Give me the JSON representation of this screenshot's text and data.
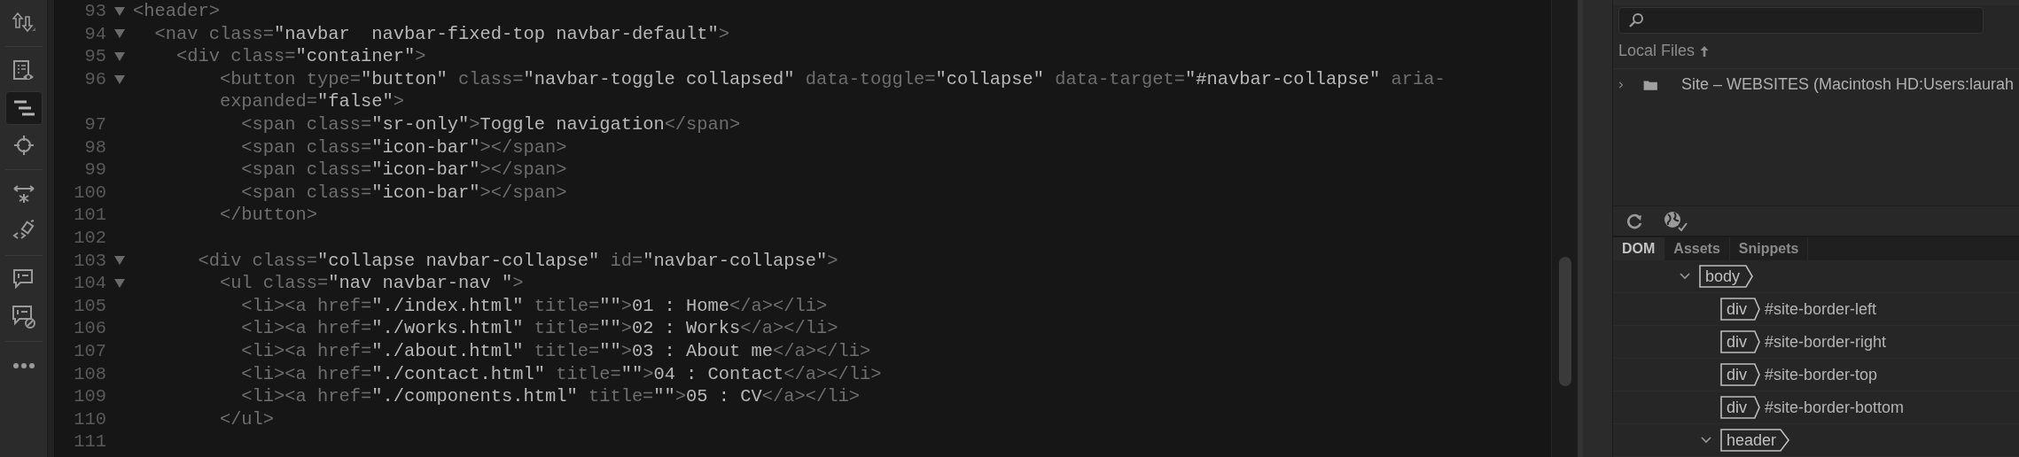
{
  "toolbar": [
    {
      "selected": false
    },
    {
      "selected": false
    },
    {
      "selected": true
    },
    {
      "selected": false
    },
    {
      "selected": false
    },
    {
      "selected": false
    },
    {
      "selected": false
    },
    {
      "selected": false
    },
    {
      "selected": false
    }
  ],
  "code_lines": [
    {
      "number": "93",
      "foldable": true,
      "segments": [
        {
          "kind": "tag",
          "text": "<header>"
        }
      ]
    },
    {
      "number": "94",
      "foldable": true,
      "segments": [
        {
          "kind": "tag",
          "text": "  <nav class="
        },
        {
          "kind": "value",
          "text": "\"navbar  navbar-fixed-top navbar-default\""
        },
        {
          "kind": "tag",
          "text": ">"
        }
      ]
    },
    {
      "number": "95",
      "foldable": true,
      "segments": [
        {
          "kind": "tag",
          "text": "    <div class="
        },
        {
          "kind": "value",
          "text": "\"container\""
        },
        {
          "kind": "tag",
          "text": ">"
        }
      ]
    },
    {
      "number": "96",
      "foldable": true,
      "segments": [
        {
          "kind": "tag",
          "text": "        <button type="
        },
        {
          "kind": "value",
          "text": "\"button\""
        },
        {
          "kind": "tag",
          "text": " class="
        },
        {
          "kind": "value",
          "text": "\"navbar-toggle collapsed\""
        },
        {
          "kind": "tag",
          "text": " data-toggle="
        },
        {
          "kind": "value",
          "text": "\"collapse\""
        },
        {
          "kind": "tag",
          "text": " data-target="
        },
        {
          "kind": "value",
          "text": "\"#navbar-collapse\""
        },
        {
          "kind": "tag",
          "text": " aria-"
        }
      ],
      "wrapped_segments": [
        {
          "kind": "tag",
          "text": "        expanded="
        },
        {
          "kind": "value",
          "text": "\"false\""
        },
        {
          "kind": "tag",
          "text": ">"
        }
      ]
    },
    {
      "number": "97",
      "foldable": false,
      "segments": [
        {
          "kind": "tag",
          "text": "          <span class="
        },
        {
          "kind": "value",
          "text": "\"sr-only\""
        },
        {
          "kind": "tag",
          "text": ">"
        },
        {
          "kind": "text",
          "text": "Toggle navigation"
        },
        {
          "kind": "tag",
          "text": "</span>"
        }
      ]
    },
    {
      "number": "98",
      "foldable": false,
      "segments": [
        {
          "kind": "tag",
          "text": "          <span class="
        },
        {
          "kind": "value",
          "text": "\"icon-bar\""
        },
        {
          "kind": "tag",
          "text": "></span>"
        }
      ]
    },
    {
      "number": "99",
      "foldable": false,
      "segments": [
        {
          "kind": "tag",
          "text": "          <span class="
        },
        {
          "kind": "value",
          "text": "\"icon-bar\""
        },
        {
          "kind": "tag",
          "text": "></span>"
        }
      ]
    },
    {
      "number": "100",
      "foldable": false,
      "segments": [
        {
          "kind": "tag",
          "text": "          <span class="
        },
        {
          "kind": "value",
          "text": "\"icon-bar\""
        },
        {
          "kind": "tag",
          "text": "></span>"
        }
      ]
    },
    {
      "number": "101",
      "foldable": false,
      "segments": [
        {
          "kind": "tag",
          "text": "        </button>"
        }
      ]
    },
    {
      "number": "102",
      "foldable": false
    },
    {
      "number": "103",
      "foldable": true,
      "segments": [
        {
          "kind": "tag",
          "text": "      <div class="
        },
        {
          "kind": "value",
          "text": "\"collapse navbar-collapse\""
        },
        {
          "kind": "tag",
          "text": " id="
        },
        {
          "kind": "value",
          "text": "\"navbar-collapse\""
        },
        {
          "kind": "tag",
          "text": ">"
        }
      ]
    },
    {
      "number": "104",
      "foldable": true,
      "segments": [
        {
          "kind": "tag",
          "text": "        <ul class="
        },
        {
          "kind": "value",
          "text": "\"nav navbar-nav \""
        },
        {
          "kind": "tag",
          "text": ">"
        }
      ]
    },
    {
      "number": "105",
      "foldable": false,
      "segments": [
        {
          "kind": "tag",
          "text": "          <li><a href="
        },
        {
          "kind": "value",
          "text": "\"./index.html\""
        },
        {
          "kind": "tag",
          "text": " title="
        },
        {
          "kind": "value",
          "text": "\"\""
        },
        {
          "kind": "tag",
          "text": ">"
        },
        {
          "kind": "text",
          "text": "01 : Home"
        },
        {
          "kind": "tag",
          "text": "</a></li>"
        }
      ]
    },
    {
      "number": "106",
      "foldable": false,
      "segments": [
        {
          "kind": "tag",
          "text": "          <li><a href="
        },
        {
          "kind": "value",
          "text": "\"./works.html\""
        },
        {
          "kind": "tag",
          "text": " title="
        },
        {
          "kind": "value",
          "text": "\"\""
        },
        {
          "kind": "tag",
          "text": ">"
        },
        {
          "kind": "text",
          "text": "02 : Works"
        },
        {
          "kind": "tag",
          "text": "</a></li>"
        }
      ]
    },
    {
      "number": "107",
      "foldable": false,
      "segments": [
        {
          "kind": "tag",
          "text": "          <li><a href="
        },
        {
          "kind": "value",
          "text": "\"./about.html\""
        },
        {
          "kind": "tag",
          "text": " title="
        },
        {
          "kind": "value",
          "text": "\"\""
        },
        {
          "kind": "tag",
          "text": ">"
        },
        {
          "kind": "text",
          "text": "03 : About me"
        },
        {
          "kind": "tag",
          "text": "</a></li>"
        }
      ]
    },
    {
      "number": "108",
      "foldable": false,
      "segments": [
        {
          "kind": "tag",
          "text": "          <li><a href="
        },
        {
          "kind": "value",
          "text": "\"./contact.html\""
        },
        {
          "kind": "tag",
          "text": " title="
        },
        {
          "kind": "value",
          "text": "\"\""
        },
        {
          "kind": "tag",
          "text": ">"
        },
        {
          "kind": "text",
          "text": "04 : Contact"
        },
        {
          "kind": "tag",
          "text": "</a></li>"
        }
      ]
    },
    {
      "number": "109",
      "foldable": false,
      "segments": [
        {
          "kind": "tag",
          "text": "          <li><a href="
        },
        {
          "kind": "value",
          "text": "\"./components.html\""
        },
        {
          "kind": "tag",
          "text": " title="
        },
        {
          "kind": "value",
          "text": "\"\""
        },
        {
          "kind": "tag",
          "text": ">"
        },
        {
          "kind": "text",
          "text": "05 : CV"
        },
        {
          "kind": "tag",
          "text": "</a></li>"
        }
      ]
    },
    {
      "number": "110",
      "foldable": false,
      "segments": [
        {
          "kind": "tag",
          "text": "        </ul>"
        }
      ]
    },
    {
      "number": "111",
      "foldable": false
    }
  ],
  "files_panel": {
    "header": "Local Files",
    "items": [
      {
        "label": "Site – WEBSITES (Macintosh HD:Users:laurah",
        "expanded": false
      }
    ]
  },
  "panel_tabs": [
    {
      "label": "DOM",
      "selected": true
    },
    {
      "label": "Assets",
      "selected": false
    },
    {
      "label": "Snippets",
      "selected": false
    }
  ],
  "dom_tree": [
    {
      "tag": "body",
      "expanded": true,
      "children": [
        {
          "tag": "div",
          "id": "#site-border-left"
        },
        {
          "tag": "div",
          "id": "#site-border-right"
        },
        {
          "tag": "div",
          "id": "#site-border-top"
        },
        {
          "tag": "div",
          "id": "#site-border-bottom"
        },
        {
          "tag": "header",
          "expanded": true
        }
      ]
    }
  ]
}
